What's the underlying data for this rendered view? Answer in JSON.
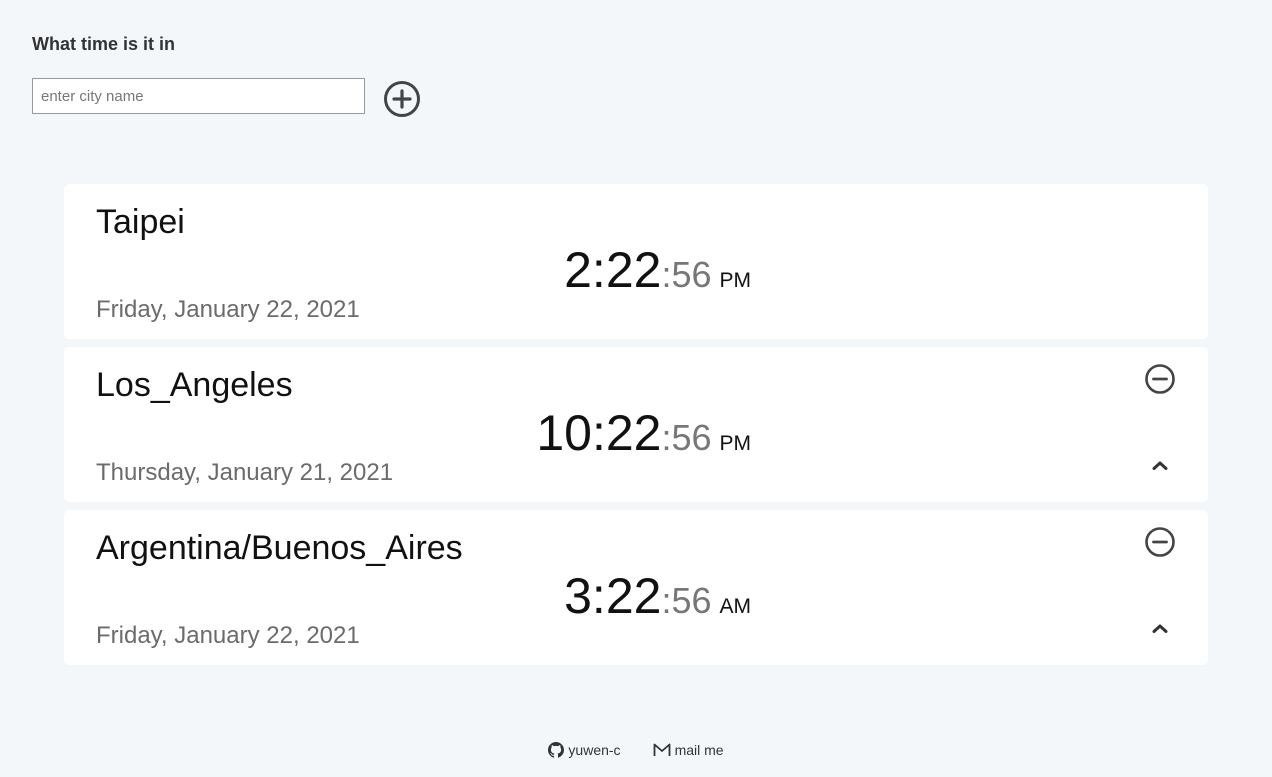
{
  "header": {
    "title": "What time is it in",
    "search_placeholder": "enter city name",
    "add_icon": "plus-circle-icon"
  },
  "cities": [
    {
      "name": "Taipei",
      "time_main": "2:22",
      "time_seconds": ":56",
      "ampm": "PM",
      "date": "Friday, January 22, 2021",
      "removable": false
    },
    {
      "name": "Los_Angeles",
      "time_main": "10:22",
      "time_seconds": ":56",
      "ampm": "PM",
      "date": "Thursday, January 21, 2021",
      "removable": true
    },
    {
      "name": "Argentina/Buenos_Aires",
      "time_main": "3:22",
      "time_seconds": ":56",
      "ampm": "AM",
      "date": "Friday, January 22, 2021",
      "removable": true
    }
  ],
  "icons": {
    "remove": "minus-circle-icon",
    "collapse": "chevron-up-icon"
  },
  "footer": {
    "github_label": "yuwen-c",
    "mail_label": "mail me"
  },
  "colors": {
    "background": "#f4f7fa",
    "card": "#ffffff",
    "icon": "#444444",
    "muted_text": "#6b6b6b"
  }
}
